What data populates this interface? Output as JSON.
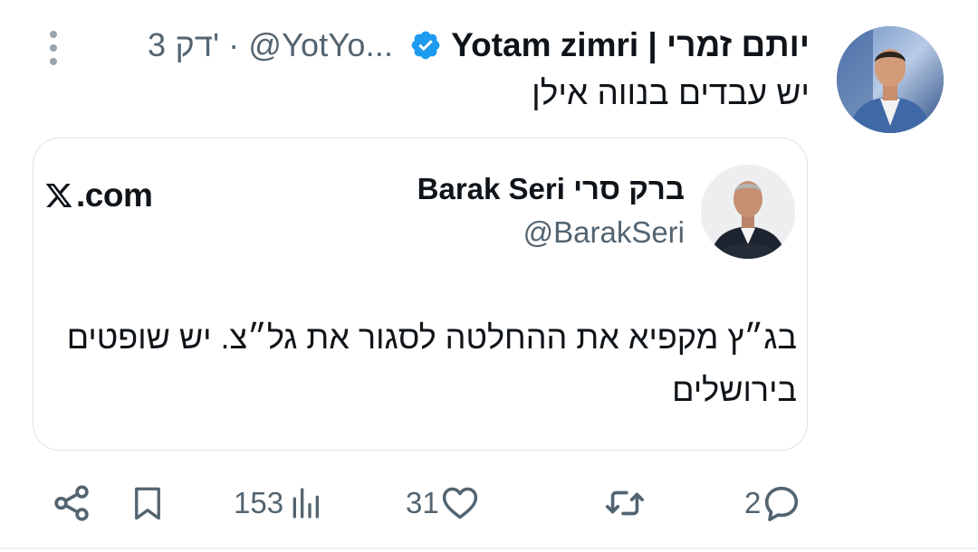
{
  "tweet": {
    "author_name": "יותם זמרי | Yotam zimri",
    "handle": "@YotYo...",
    "separator": "·",
    "time_ago": "3 דק'",
    "text": "יש עבדים בנווה אילן"
  },
  "quote": {
    "author_name": "ברק סרי Barak Seri",
    "handle": "@BarakSeri",
    "source": ".com",
    "text_lines": [
      "בג״ץ מקפיא את ההחלטה לסגור את גל״צ. יש שופטים",
      "בירושלים"
    ]
  },
  "actions": {
    "replies": "2",
    "reposts": "",
    "likes": "31",
    "views": "153"
  },
  "icons": {
    "verified": "verified-badge-icon",
    "more": "more-vertical-icon",
    "x_logo": "x-logo-icon",
    "reply": "reply-icon",
    "repost": "repost-icon",
    "like": "heart-icon",
    "views": "views-icon",
    "bookmark": "bookmark-icon",
    "share": "share-icon"
  },
  "colors": {
    "verified_blue": "#1d9bf0",
    "text_primary": "#0f1419",
    "text_secondary": "#536471",
    "border": "#dfe3e7"
  }
}
